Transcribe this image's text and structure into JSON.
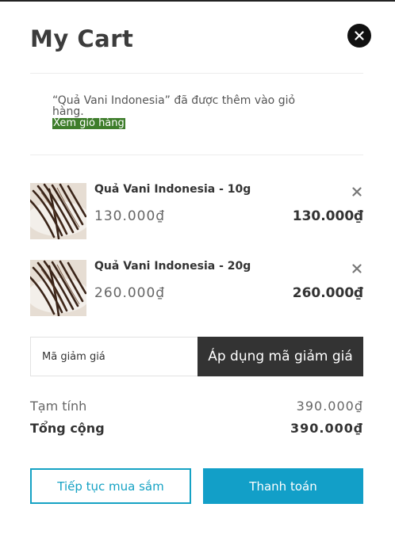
{
  "cart": {
    "title": "My Cart",
    "notice_text": "“Quả Vani Indonesia” đã được thêm vào giỏ hàng.",
    "notice_link": "Xem giỏ hàng",
    "items": [
      {
        "name": "Quả Vani Indonesia - 10g",
        "unit_price": "130.000₫",
        "line_total": "130.000₫",
        "image": "vanilla-beans-photo"
      },
      {
        "name": "Quả Vani Indonesia - 20g",
        "unit_price": "260.000₫",
        "line_total": "260.000₫",
        "image": "vanilla-beans-photo"
      }
    ],
    "coupon": {
      "placeholder": "Mã giảm giá",
      "apply_label": "Áp dụng mã giảm giá"
    },
    "summary": {
      "subtotal_label": "Tạm tính",
      "subtotal_value": "390.000₫",
      "total_label": "Tổng cộng",
      "total_value": "390.000₫"
    },
    "actions": {
      "continue_label": "Tiếp tục mua sắm",
      "checkout_label": "Thanh toán"
    }
  },
  "colors": {
    "accent": "#129fc8",
    "notice_link_bg": "#3e7d2b",
    "dark_button": "#333333"
  },
  "icons": {
    "close": "close-icon",
    "remove": "remove-icon"
  }
}
